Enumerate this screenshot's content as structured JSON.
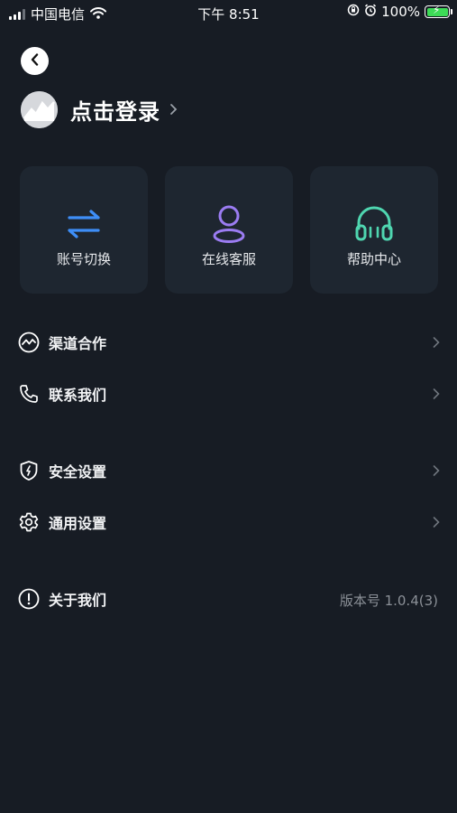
{
  "status_bar": {
    "carrier": "中国电信",
    "time": "下午 8:51",
    "battery": "100%"
  },
  "profile": {
    "login_label": "点击登录"
  },
  "quick_actions": [
    {
      "label": "账号切换",
      "icon": "switch-arrows-icon",
      "color": "#3e8ef7"
    },
    {
      "label": "在线客服",
      "icon": "person-icon",
      "color": "#9b7cf2"
    },
    {
      "label": "帮助中心",
      "icon": "headphones-icon",
      "color": "#4fd6b0"
    }
  ],
  "menu": [
    {
      "label": "渠道合作",
      "icon": "cooperation-icon"
    },
    {
      "label": "联系我们",
      "icon": "phone-icon"
    },
    {
      "label": "安全设置",
      "icon": "shield-icon"
    },
    {
      "label": "通用设置",
      "icon": "gear-icon"
    },
    {
      "label": "关于我们",
      "icon": "info-icon",
      "value": "版本号 1.0.4(3)"
    }
  ]
}
